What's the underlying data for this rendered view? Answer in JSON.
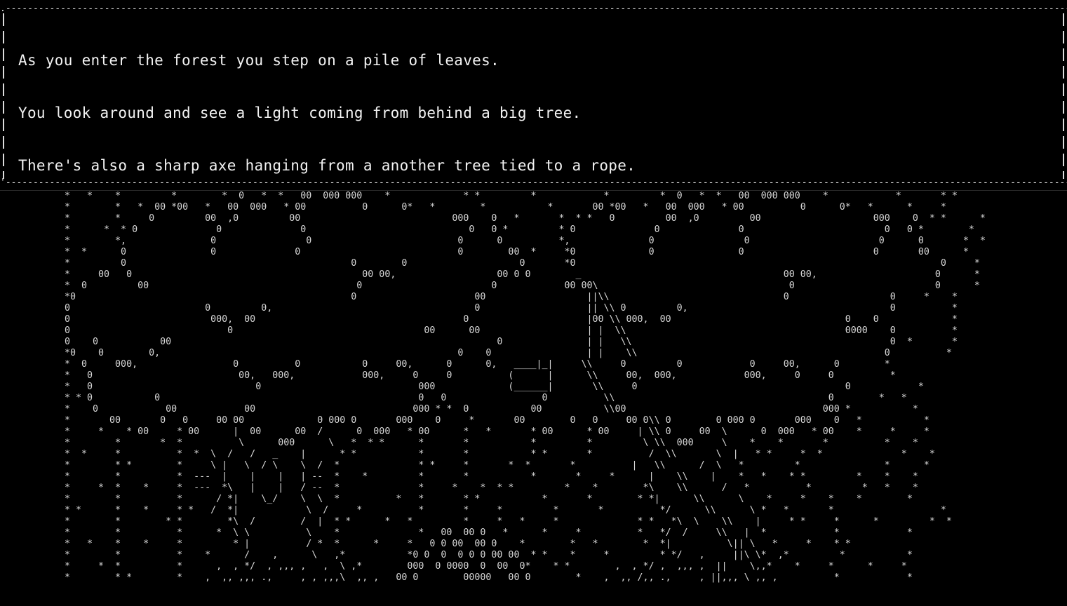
{
  "narration": {
    "lines": [
      "As you enter the forest you step on a pile of leaves.",
      "You look around and see a light coming from behind a big tree.",
      "There's also a sharp axe hanging from a another tree tied to a rope."
    ]
  },
  "scene": {
    "art": " *   *    *         *        *  0   *  *   00  000 000    *             * *         *            *         *  0   *  *   00  000 000    *            *       * *\n *        *   *  00 *00   *   00  000   * 00          0      0*   *        *           *       00 *00   *   00  000   * 00          0      0*   *      *     *\n *        *     0         00  ,0         00                           000    0   *       *  * *   0         00  ,0         00                    000    0  * *      *\n *      *  * 0              0              0                             0   0 *         * 0              0              0                         0   0 *        *\n *        *,               0                0                          0      0          *,              0                0                       0      0       *  *\n *  *      0               0              0                            0        00  *     *0             0               0                       0       00      *\n *         0                                        0        0                    0       *0                                                                 0     *\n *     00   0                                         00 00,                  00 0 0        _                                    00 00,                     0      *\n *  0         00                                     0                       0            00 00\\                                  0                         0      *\n *0                                                 0                     00                  ||\\\\                               0                  0     *    *\n 0                        0         0,                                    0                   || \\\\ 0         0,                                    0          *\n 0                         000,  00                                     0                     |00 \\\\ 000,  00                               0    0             *\n 0                            0                                  00      00                   | |  \\\\                                       0000    0          *\n 0    0           00                                                          0               | |   \\\\                                              0  *       *\n *0    0        0,                                                     0    0                 | |    \\\\                                            0          *\n *  0     000,                 0          0           0     00,      0      0,   ____|_|     \\\\     0         0            0     00,      0        *\n *   0                          00,   000,            000,     0     0          (      |      \\\\     00,  000,            000,     0     0          *\n *   0                             0                            000             (______|       \\\\     0                                     0            *\n * * 0           0                                              0   0                 0          \\\\                                      0        *   *\n *    0            00            00                            000 * *  0           00           \\\\00                                   000 *           *\n *       00       0   0     00 00             0 000 0       000    0     *       00        0   0     00 0\\\\ 0        0 000 0       000    0   *           *\n *     *    * 00     * 00      |  00      00  /      0  000   * 00      *   *       * 00      * 00     | \\\\ 0     00  \\      0  000   * 00    *     *     *\n *        *       *  *          \\      000      \\   *  * *      *       *           *         *         \\ \\\\  000     \\    *    *       *          *    *\n *  *     *          *  *  \\  /   /   _    |      * *           *       *           * *       *          /  \\\\       \\  |   * *     *  *              *    *\n *        * *        *     \\ |   \\  / \\    \\  /  *              * *     *       *  *       *          |   \\\\      /  \\   *         *               *      *\n *        *          *  ---  |    |    |   | --  *    *         *       *           *       *     *      |    \\\\    |    *   *    * *         *    *    *\n *     *  *    *     *  ---  *\\   |    |   / --  *              *     *    *  * *         *    *        *\\    \\\\      /   *          *         *   *    *\n *        *          *      / *|    \\_/    \\  \\  *          *   *       * *           *       *        * *|      \\\\      \\    *     *    *    *        *\n * *      *    *     * *   /  *|            \\  /     *          *       *     *         *       *          */      \\\\      \\ *   *       *                   *\n *        *        * *        *\\  /        /  |  * *      *   *         *     *   *     *              * *   *\\  \\    \\\\    |     * *     *      *         *  *\n *        *          *      *  \\ \\          \\    *              *   00  00 0   *      *     *          *   */  /     \\\\   |  *            *            *\n *   *    *    *     *         * |          / *  *      *     *   0 0 00  00 0    *        *   *        *  *|          \\|| \\   *     *    * *\n *        *          *    *      /    ,      \\   ,*           *0 0  0  0 0 0 00 00  * *    *     *         * */   ,     ||\\ \\*  ,*         *           *\n *     *  *          *      ,  , */  , ,,, ,   ,  \\ ,*        000  0 0000  0  00  0*    * *        ,  , */ ,  ,,, ,  ||    \\,,*    *     *      *     *\n *        * *        *    ,  ,, ,,, .,     , , ,,,\\  ,, ,   00 0        00000   00 0        *    ,  ,, /,, .,     , ||,,, \\ ,, ,          *            *"
  }
}
